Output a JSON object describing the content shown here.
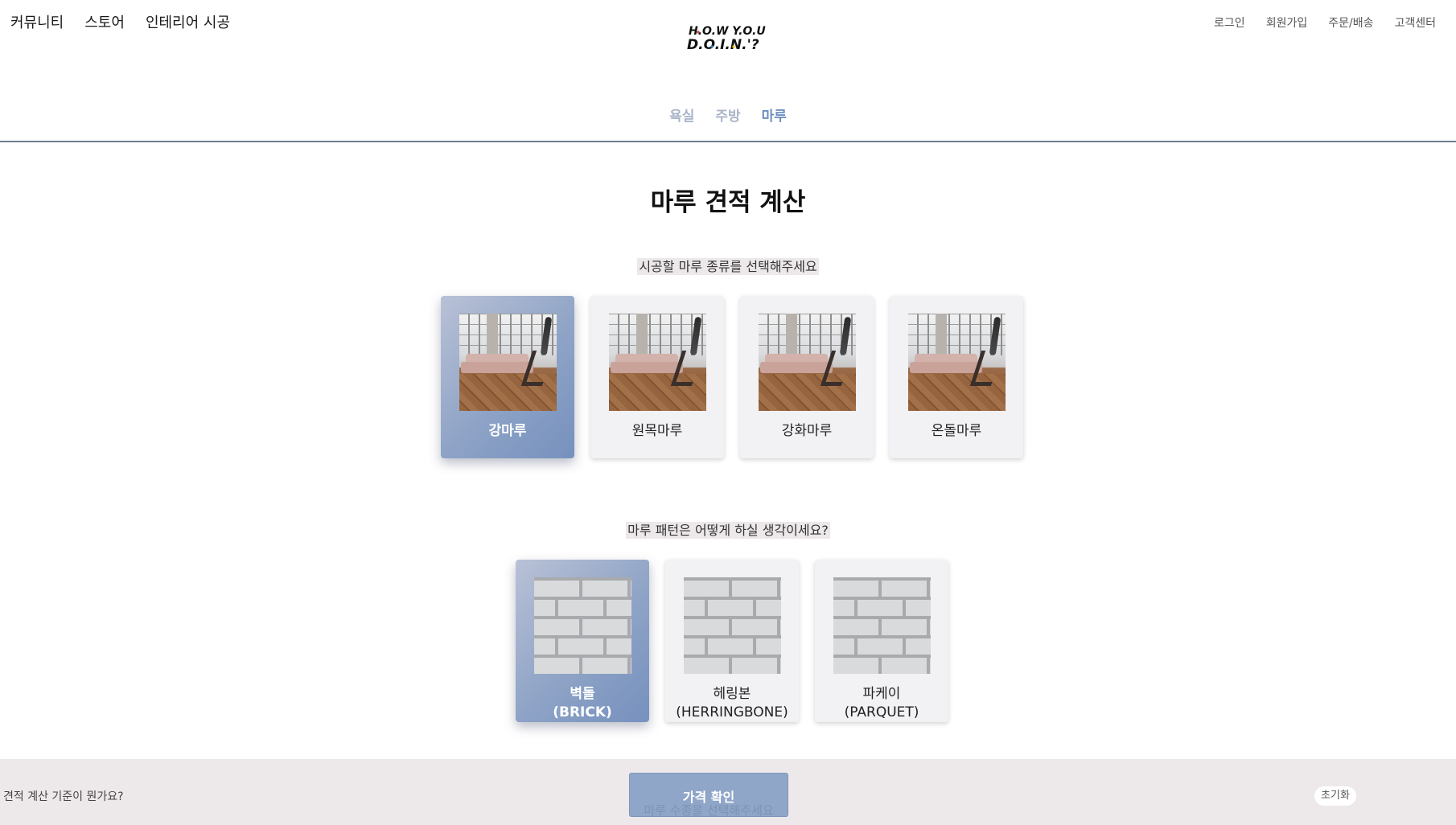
{
  "header": {
    "main_nav": [
      "커뮤니티",
      "스토어",
      "인테리어 시공"
    ],
    "logo_text": "HOW YOU DOIN'?",
    "util_nav": [
      "로그인",
      "회원가입",
      "주문/배송",
      "고객센터"
    ]
  },
  "tabs": [
    {
      "label": "욕실",
      "active": false
    },
    {
      "label": "주방",
      "active": false
    },
    {
      "label": "마루",
      "active": true
    }
  ],
  "title": "마루 견적 계산",
  "section1": {
    "question": "시공할 마루 종류를 선택해주세요",
    "options": [
      {
        "label": "강마루",
        "selected": true
      },
      {
        "label": "원목마루",
        "selected": false
      },
      {
        "label": "강화마루",
        "selected": false
      },
      {
        "label": "온돌마루",
        "selected": false
      }
    ]
  },
  "section2": {
    "question": "마루 패턴은 어떻게 하실 생각이세요?",
    "options": [
      {
        "label_line1": "벽돌",
        "label_line2": "(BRICK)",
        "selected": true
      },
      {
        "label_line1": "헤링본",
        "label_line2": "(HERRINGBONE)",
        "selected": false
      },
      {
        "label_line1": "파케이",
        "label_line2": "(PARQUET)",
        "selected": false
      }
    ]
  },
  "bottom_bar": {
    "criteria_link": "견적 계산 기준이 뭔가요?",
    "price_button": "가격 확인",
    "price_sub": "마루 수종을 선택해주세요",
    "reset_button": "초기화"
  },
  "colors": {
    "accent": "#6d8fbe",
    "tab_inactive": "#a9b4c8",
    "selected_card_start": "#b9c1d6",
    "selected_card_end": "#7691be",
    "bottom_bar_bg": "#ede8ea"
  }
}
